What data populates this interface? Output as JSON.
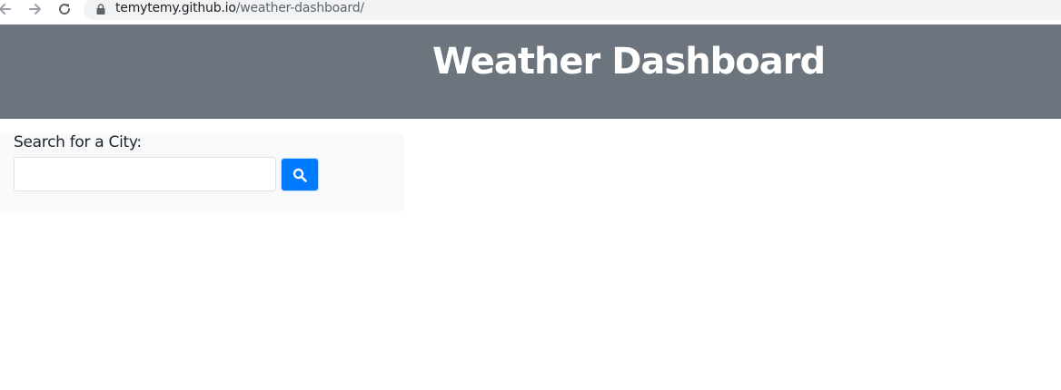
{
  "browser": {
    "url_host": "temytemy.github.io",
    "url_path": "/weather-dashboard/"
  },
  "header": {
    "title": "Weather Dashboard"
  },
  "search": {
    "label": "Search for a City:",
    "value": "",
    "placeholder": "",
    "button_icon": "search-icon"
  },
  "colors": {
    "header_bg": "#6c757d",
    "panel_bg": "#f8f9fa",
    "button_bg": "#007bff"
  }
}
